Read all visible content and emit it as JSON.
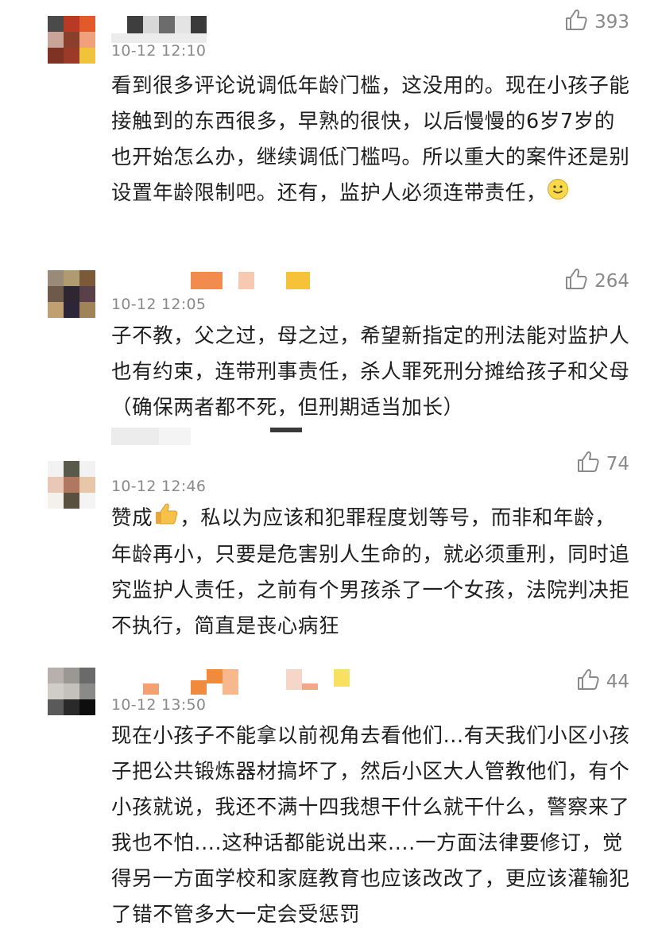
{
  "comments": [
    {
      "time": "10-12 12:10",
      "likes": "393",
      "text_before": "看到很多评论说调低年龄门槛，这没用的。现在小孩子能接触到的东西很多，早熟的很快，以后慢慢的6岁7岁的也开始怎么办，继续调低门槛吗。所以重大的案件还是别设置年龄限制吧。还有，监护人必须连带责任，",
      "text_after": "",
      "emoji": "smile-emoji"
    },
    {
      "time": "10-12 12:05",
      "likes": "264",
      "text_before": "子不教，父之过，母之过，希望新指定的刑法能对监护人也有约束，连带刑事责任，杀人罪死刑分摊给孩子和父母（确保两者都不死，但刑期适当加长）",
      "text_after": "",
      "emoji": ""
    },
    {
      "time": "10-12 12:46",
      "likes": "74",
      "text_before": "赞成",
      "text_after": "，私以为应该和犯罪程度划等号，而非和年龄，年龄再小，只要是危害别人生命的，就必须重刑，同时追究监护人责任，之前有个男孩杀了一个女孩，法院判决拒不执行，简直是丧心病狂",
      "emoji": "thumbs-up-emoji"
    },
    {
      "time": "10-12 13:50",
      "likes": "44",
      "text_before": "现在小孩子不能拿以前视角去看他们...有天我们小区小孩子把公共锻炼器材搞坏了，然后小区大人管教他们，有个小孩就说，我还不满十四我想干什么就干什么，警察来了我也不怕....这种话都能说出来....一方面法律要修订，觉得另一方面学校和家庭教育也应该改改了，更应该灌输犯了错不管多大一定会受惩罚",
      "text_after": "",
      "emoji": ""
    }
  ],
  "colors": {
    "timestamp": "#8a8a8a",
    "like_count": "#8a8a8a",
    "body_text": "#1f1f1f"
  },
  "icons": {
    "like": "thumbs-up-outline-icon"
  }
}
